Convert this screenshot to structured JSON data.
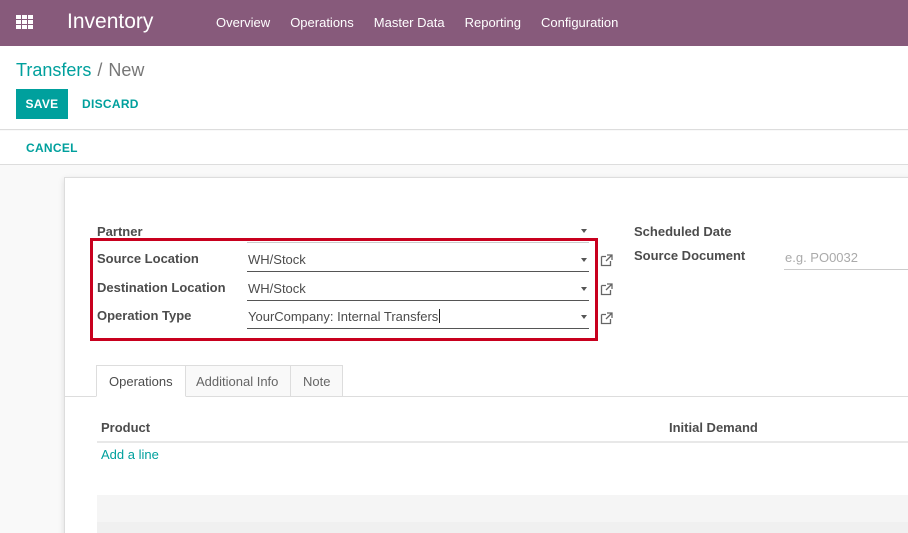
{
  "navbar": {
    "app_name": "Inventory",
    "menu": [
      "Overview",
      "Operations",
      "Master Data",
      "Reporting",
      "Configuration"
    ]
  },
  "breadcrumb": {
    "parent": "Transfers",
    "separator": "/",
    "current": "New"
  },
  "buttons": {
    "save": "SAVE",
    "discard": "DISCARD",
    "cancel": "CANCEL"
  },
  "form": {
    "partner": {
      "label": "Partner",
      "value": ""
    },
    "source_location": {
      "label": "Source Location",
      "value": "WH/Stock"
    },
    "destination_location": {
      "label": "Destination Location",
      "value": "WH/Stock"
    },
    "operation_type": {
      "label": "Operation Type",
      "value": "YourCompany: Internal Transfers"
    },
    "scheduled_date": {
      "label": "Scheduled Date"
    },
    "source_document": {
      "label": "Source Document",
      "placeholder": "e.g. PO0032"
    }
  },
  "tabs": [
    "Operations",
    "Additional Info",
    "Note"
  ],
  "operations_table": {
    "columns": [
      "Product",
      "Initial Demand"
    ],
    "add_line": "Add a line"
  },
  "colors": {
    "navbar": "#875a7b",
    "accent": "#00a09d",
    "highlight": "#c8001e"
  }
}
